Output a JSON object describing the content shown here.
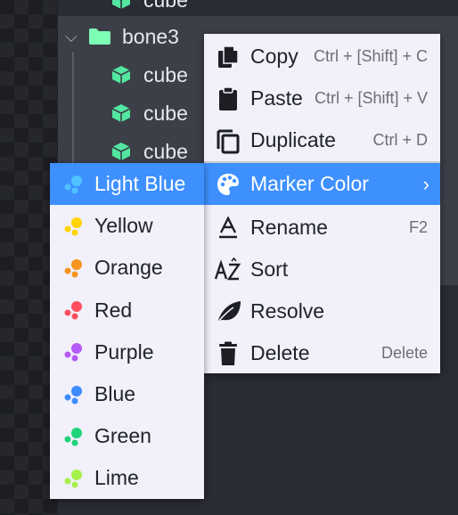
{
  "outliner": {
    "top_cube": "cube",
    "group": "bone3",
    "children": [
      "cube",
      "cube",
      "cube"
    ],
    "colors": {
      "cube": "#52e6a0",
      "folder": "#7dffb5"
    }
  },
  "context_menu": {
    "items": [
      {
        "label": "Copy",
        "shortcut": "Ctrl + [Shift] + C",
        "icon": "copy-icon"
      },
      {
        "label": "Paste",
        "shortcut": "Ctrl + [Shift] + V",
        "icon": "paste-icon"
      },
      {
        "label": "Duplicate",
        "shortcut": "Ctrl + D",
        "icon": "duplicate-icon"
      },
      {
        "label": "Marker Color",
        "shortcut": "",
        "icon": "palette-icon",
        "highlighted": true
      },
      {
        "label": "Rename",
        "shortcut": "F2",
        "icon": "rename-icon"
      },
      {
        "label": "Sort",
        "shortcut": "",
        "icon": "sort-icon"
      },
      {
        "label": "Resolve",
        "shortcut": "",
        "icon": "leaf-icon"
      },
      {
        "label": "Delete",
        "shortcut": "Delete",
        "icon": "trash-icon"
      }
    ],
    "highlight_color": "#3e90ff"
  },
  "marker_colors": {
    "items": [
      {
        "label": "Light Blue",
        "color": "#4fc3ff",
        "highlighted": true
      },
      {
        "label": "Yellow",
        "color": "#ffd400"
      },
      {
        "label": "Orange",
        "color": "#f5941e"
      },
      {
        "label": "Red",
        "color": "#ff4f5e"
      },
      {
        "label": "Purple",
        "color": "#b45cf5"
      },
      {
        "label": "Blue",
        "color": "#3e8bff"
      },
      {
        "label": "Green",
        "color": "#1ed37a"
      },
      {
        "label": "Lime",
        "color": "#a6f04a"
      }
    ]
  }
}
